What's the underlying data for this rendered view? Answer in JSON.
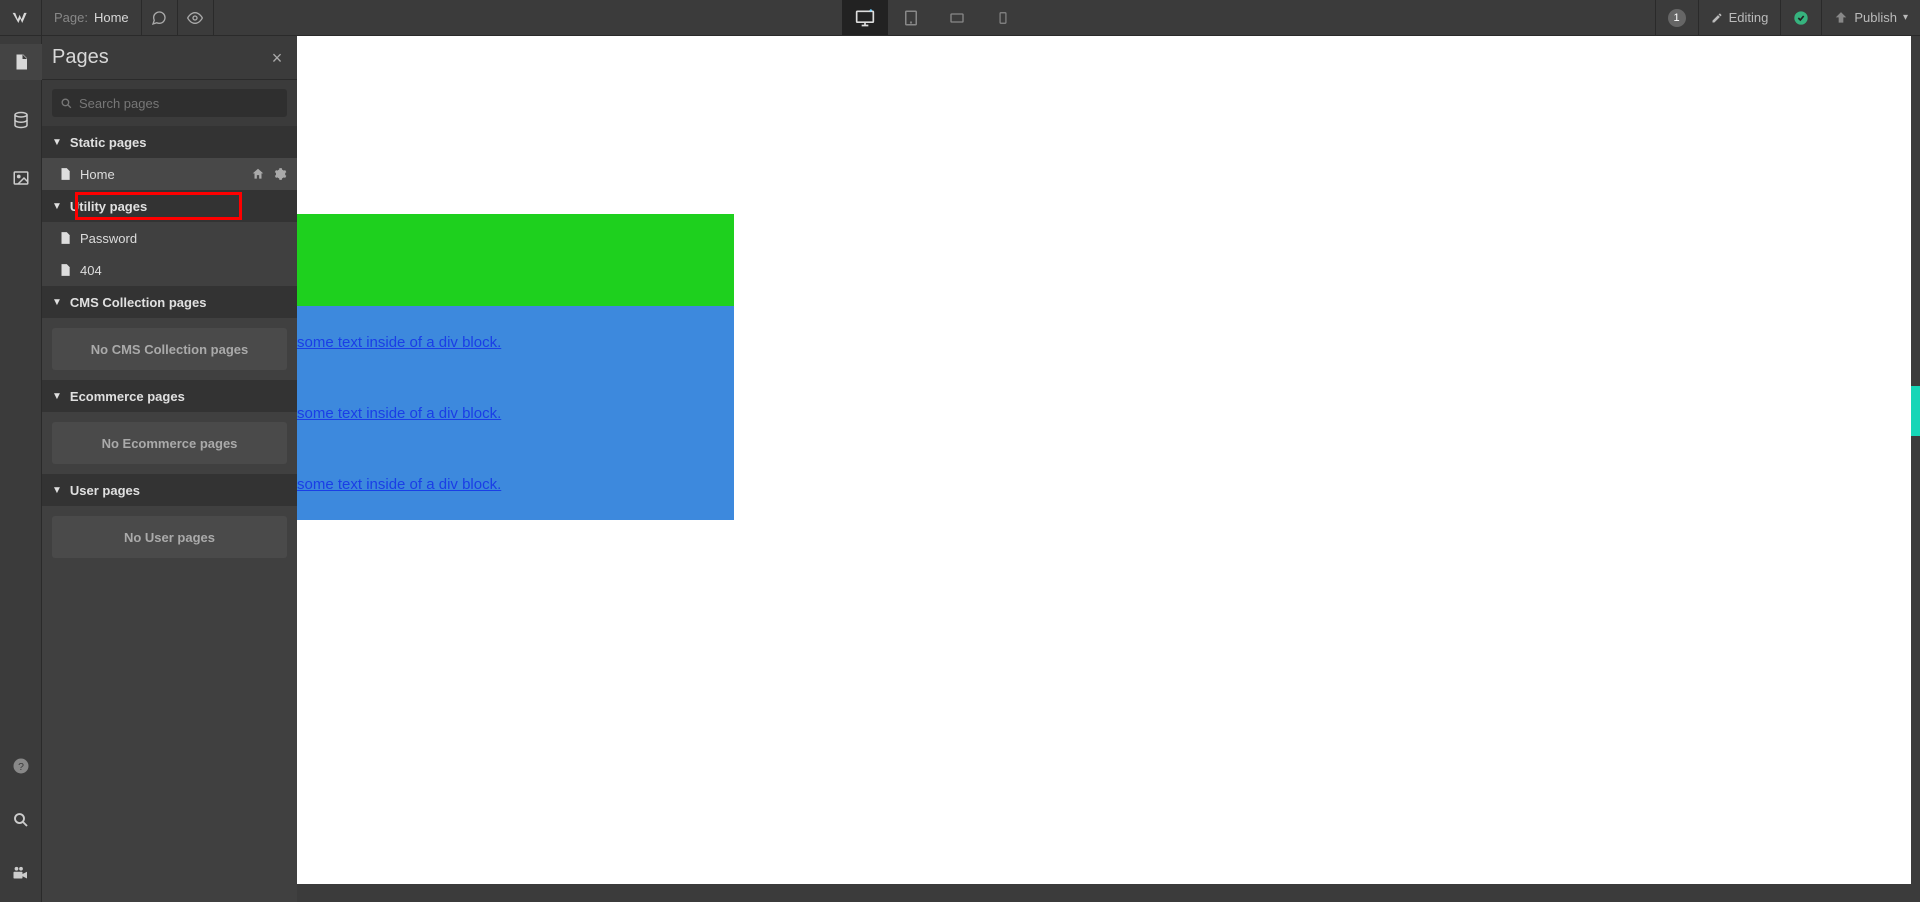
{
  "topbar": {
    "page_label": "Page:",
    "page_name": "Home",
    "editing": "Editing",
    "publish": "Publish",
    "badge": "1"
  },
  "panel": {
    "title": "Pages",
    "search_placeholder": "Search pages",
    "sections": {
      "static": "Static pages",
      "utility": "Utility pages",
      "cms": "CMS Collection pages",
      "ecommerce": "Ecommerce pages",
      "user": "User pages"
    },
    "pages": {
      "home": "Home",
      "password": "Password",
      "notfound": "404"
    },
    "empty": {
      "cms": "No CMS Collection pages",
      "ecommerce": "No Ecommerce pages",
      "user": "No User pages"
    }
  },
  "canvas": {
    "link1": "some text inside of a div block.",
    "link2": "some text inside of a div block.",
    "link3": "some text inside of a div block."
  }
}
